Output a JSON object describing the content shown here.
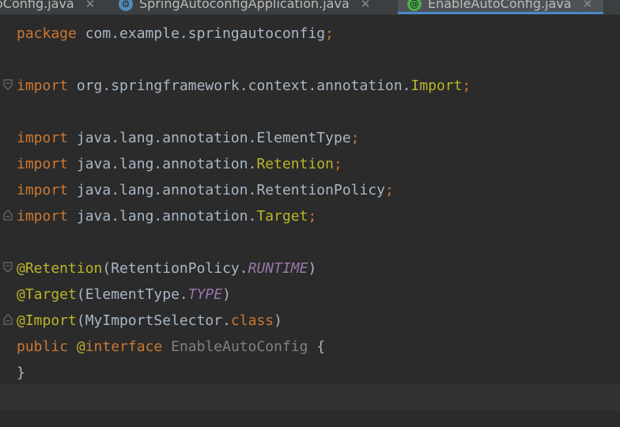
{
  "tabs": [
    {
      "label": "oConfig.java",
      "active": false,
      "icon": "class-icon"
    },
    {
      "label": "SpringAutoconfigApplication.java",
      "active": false,
      "icon": "spring-boot-icon"
    },
    {
      "label": "EnableAutoConfig.java",
      "active": true,
      "icon": "annotation-icon"
    }
  ],
  "close_glyph": "✕",
  "icons": {
    "spring": "⚙",
    "annotation": "@"
  },
  "code": {
    "l1": {
      "kw": "package",
      "rest": " com.example.springautoconfig",
      "semi": ";"
    },
    "l2": {
      "kw": "import",
      "pkg": " org.springframework.context.annotation.",
      "cls": "Import",
      "semi": ";"
    },
    "l3": {
      "kw": "import",
      "pkg": " java.lang.annotation.ElementType",
      "semi": ";"
    },
    "l4": {
      "kw": "import",
      "pkg": " java.lang.annotation.",
      "cls": "Retention",
      "semi": ";"
    },
    "l5": {
      "kw": "import",
      "pkg": " java.lang.annotation.RetentionPolicy",
      "semi": ";"
    },
    "l6": {
      "kw": "import",
      "pkg": " java.lang.annotation.",
      "cls": "Target",
      "semi": ";"
    },
    "l7": {
      "ann": "@Retention",
      "open": "(RetentionPolicy.",
      "const": "RUNTIME",
      "close": ")"
    },
    "l8": {
      "ann": "@Target",
      "open": "(ElementType.",
      "const": "TYPE",
      "close": ")"
    },
    "l9": {
      "ann": "@Import",
      "open": "(MyImportSelector.",
      "kw": "class",
      "close": ")"
    },
    "l10": {
      "kw1": "public",
      "sp": " ",
      "ann": "@",
      "kw2": "interface",
      "name": " EnableAutoConfig",
      "brace": " {"
    },
    "l11": {
      "brace": "}"
    }
  },
  "colors": {
    "background": "#2b2b2b",
    "keyword": "#cc7832",
    "annotation": "#bbb529",
    "constant": "#9876aa",
    "plain": "#a9b7c6",
    "tab_accent": "#4a88c7"
  }
}
